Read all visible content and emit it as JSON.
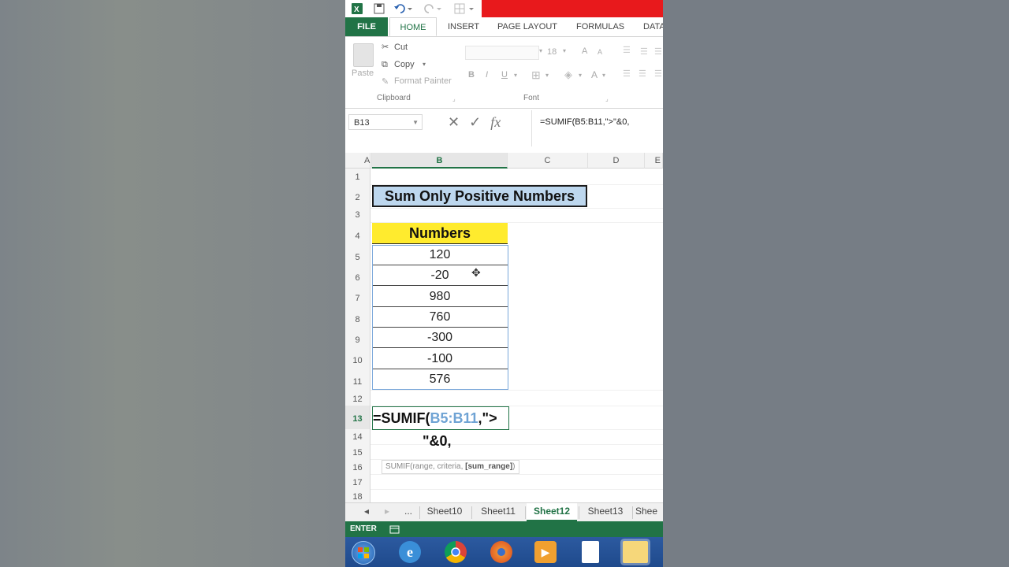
{
  "titlebar": {
    "icons": [
      "excel-icon",
      "save-icon",
      "undo-icon",
      "redo-icon",
      "table-icon"
    ]
  },
  "ribbon_tabs": [
    "FILE",
    "HOME",
    "INSERT",
    "PAGE LAYOUT",
    "FORMULAS",
    "DATA"
  ],
  "clipboard": {
    "paste": "Paste",
    "cut": "Cut",
    "copy": "Copy",
    "format_painter": "Format Painter",
    "label": "Clipboard"
  },
  "font": {
    "size": "18",
    "bold": "B",
    "italic": "I",
    "underline": "U",
    "grow": "A",
    "shrink": "A",
    "color": "A",
    "label": "Font"
  },
  "formula_bar": {
    "name_box": "B13",
    "cancel": "✕",
    "enter": "✓",
    "fx": "fx",
    "formula": "=SUMIF(B5:B11,\">\"&0,"
  },
  "columns": [
    "A",
    "B",
    "C",
    "D",
    "E"
  ],
  "rows": [
    "1",
    "2",
    "3",
    "4",
    "5",
    "6",
    "7",
    "8",
    "9",
    "10",
    "11",
    "12",
    "13",
    "14",
    "15",
    "16",
    "17",
    "18"
  ],
  "sheet": {
    "title": "Sum Only Positive Numbers",
    "header": "Numbers",
    "values": [
      "120",
      "-20",
      "980",
      "760",
      "-300",
      "-100",
      "576"
    ],
    "edit_prefix": "=SUMIF(",
    "edit_ref": "B5:B11",
    "edit_suffix": ",\">",
    "edit_continuation": "\"&0,",
    "tooltip_prefix": "SUMIF(range, criteria, ",
    "tooltip_bold": "[sum_range]",
    "tooltip_suffix": ")"
  },
  "sheet_tabs": {
    "prev": "◂",
    "next": "▸",
    "more": "...",
    "tabs": [
      "Sheet10",
      "Sheet11",
      "Sheet12",
      "Sheet13",
      "Shee"
    ],
    "active": "Sheet12"
  },
  "status": {
    "mode": "ENTER"
  },
  "colors": {
    "excel_green": "#217346",
    "title_fill": "#bdd7ee",
    "header_fill": "#ffeb2e",
    "ref_blue": "#6fa3d4"
  }
}
